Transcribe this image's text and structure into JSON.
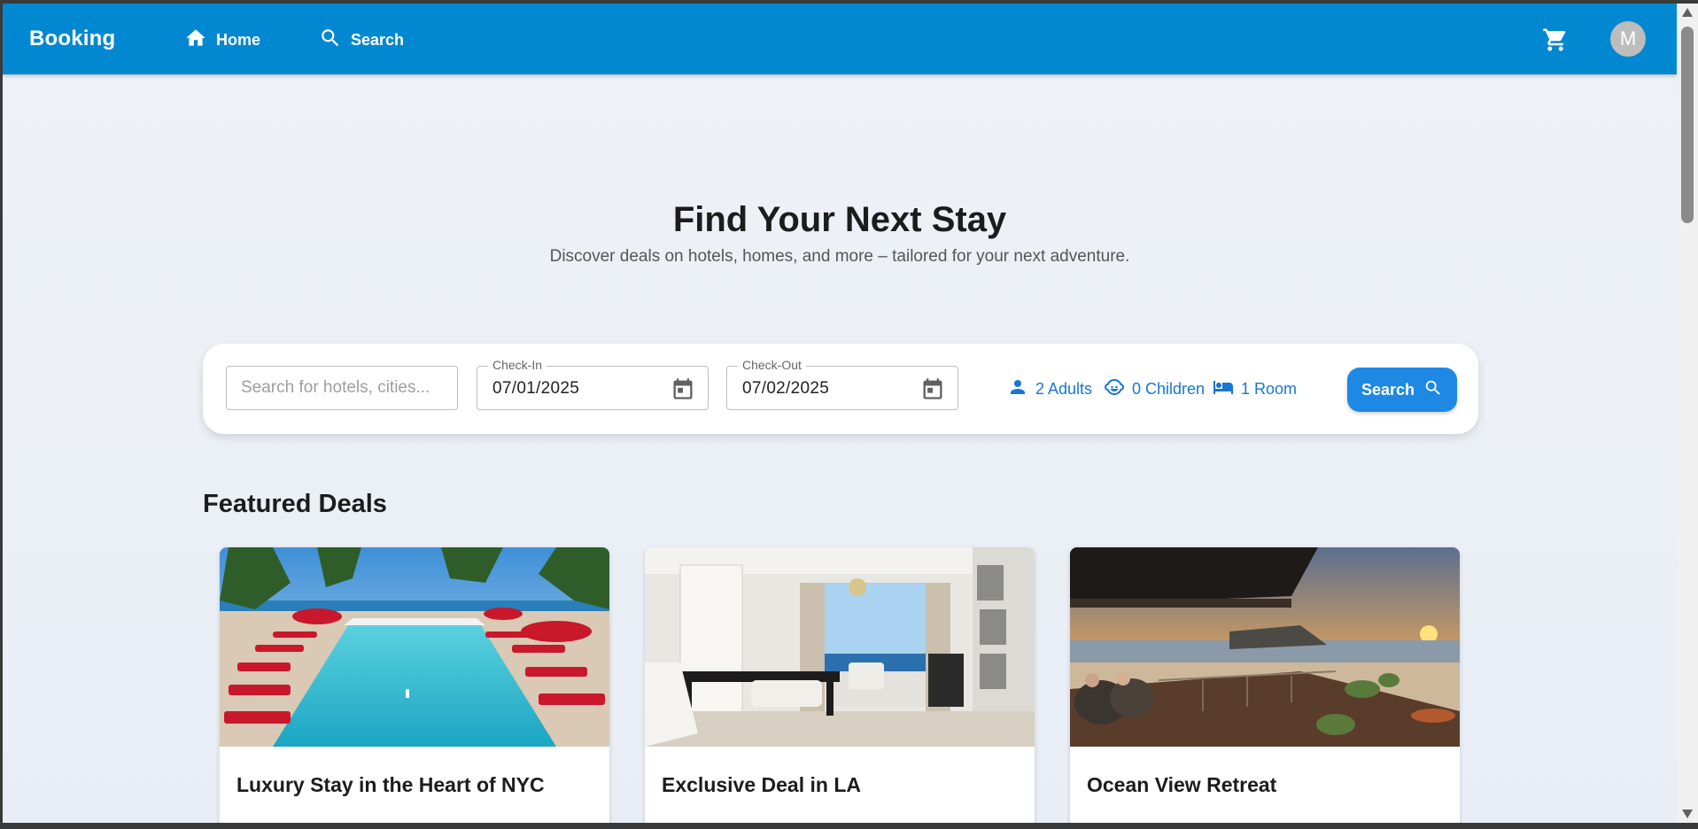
{
  "appbar": {
    "brand": "Booking",
    "nav": [
      {
        "label": "Home",
        "icon": "home-icon"
      },
      {
        "label": "Search",
        "icon": "search-icon"
      }
    ],
    "cart_icon": "cart-icon",
    "avatar_initial": "M",
    "color": "#0288d1"
  },
  "hero": {
    "title": "Find Your Next Stay",
    "subtitle": "Discover deals on hotels, homes, and more – tailored for your next adventure."
  },
  "search": {
    "placeholder": "Search for hotels, cities...",
    "value": "",
    "check_in": {
      "label": "Check-In",
      "value": "07/01/2025"
    },
    "check_out": {
      "label": "Check-Out",
      "value": "07/02/2025"
    },
    "adults": "2 Adults",
    "children": "0 Children",
    "rooms": "1 Room",
    "button_label": "Search",
    "accent": "#1e88e5"
  },
  "featured": {
    "title": "Featured Deals",
    "cards": [
      {
        "title": "Luxury Stay in the Heart of NYC",
        "image": "pool-resort-photo"
      },
      {
        "title": "Exclusive Deal in LA",
        "image": "ocean-view-suite-photo"
      },
      {
        "title": "Ocean View Retreat",
        "image": "sunset-beach-terrace-photo"
      }
    ]
  }
}
